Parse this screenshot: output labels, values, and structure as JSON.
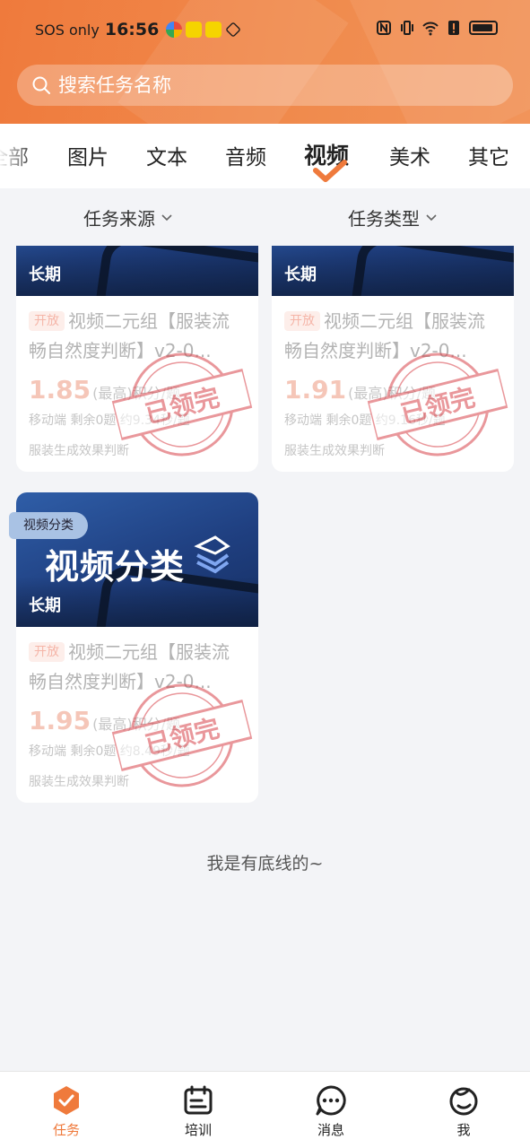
{
  "status_bar": {
    "carrier": "SOS only",
    "time": "16:56"
  },
  "search": {
    "placeholder": "搜索任务名称"
  },
  "tabs": [
    {
      "label": "全部",
      "active": false
    },
    {
      "label": "图片",
      "active": false
    },
    {
      "label": "文本",
      "active": false
    },
    {
      "label": "音频",
      "active": false
    },
    {
      "label": "视频",
      "active": true
    },
    {
      "label": "美术",
      "active": false
    },
    {
      "label": "其它",
      "active": false
    }
  ],
  "filters": {
    "source": "任务来源",
    "type": "任务类型"
  },
  "cards": [
    {
      "duration_tag": "长期",
      "open_badge": "开放",
      "title": "视频二元组【服装流畅自然度判断】v2-0...",
      "price": "1.85",
      "price_suffix": "(最高)积分/题",
      "meta": "移动端  剩余0题  约9.34秒/题",
      "desc": "服装生成效果判断",
      "stamp": "已领完"
    },
    {
      "duration_tag": "长期",
      "open_badge": "开放",
      "title": "视频二元组【服装流畅自然度判断】v2-0...",
      "price": "1.91",
      "price_suffix": "(最高)积分/题",
      "meta": "移动端  剩余0题  约9.16秒/题",
      "desc": "服装生成效果判断",
      "stamp": "已领完"
    },
    {
      "corner_tag": "视频分类",
      "banner_title": "视频分类",
      "duration_tag": "长期",
      "open_badge": "开放",
      "title": "视频二元组【服装流畅自然度判断】v2-0...",
      "price": "1.95",
      "price_suffix": "(最高)积分/题",
      "meta": "移动端  剩余0题  约8.49秒/题",
      "desc": "服装生成效果判断",
      "stamp": "已领完"
    }
  ],
  "footer_note": "我是有底线的~",
  "bottom_nav": [
    {
      "label": "任务",
      "icon": "task-icon",
      "active": true
    },
    {
      "label": "培训",
      "icon": "training-icon",
      "active": false
    },
    {
      "label": "消息",
      "icon": "message-icon",
      "active": false
    },
    {
      "label": "我",
      "icon": "profile-icon",
      "active": false
    }
  ],
  "colors": {
    "brand": "#ef7a3c",
    "stamp": "#d8434a",
    "banner": "#1f3f80"
  }
}
